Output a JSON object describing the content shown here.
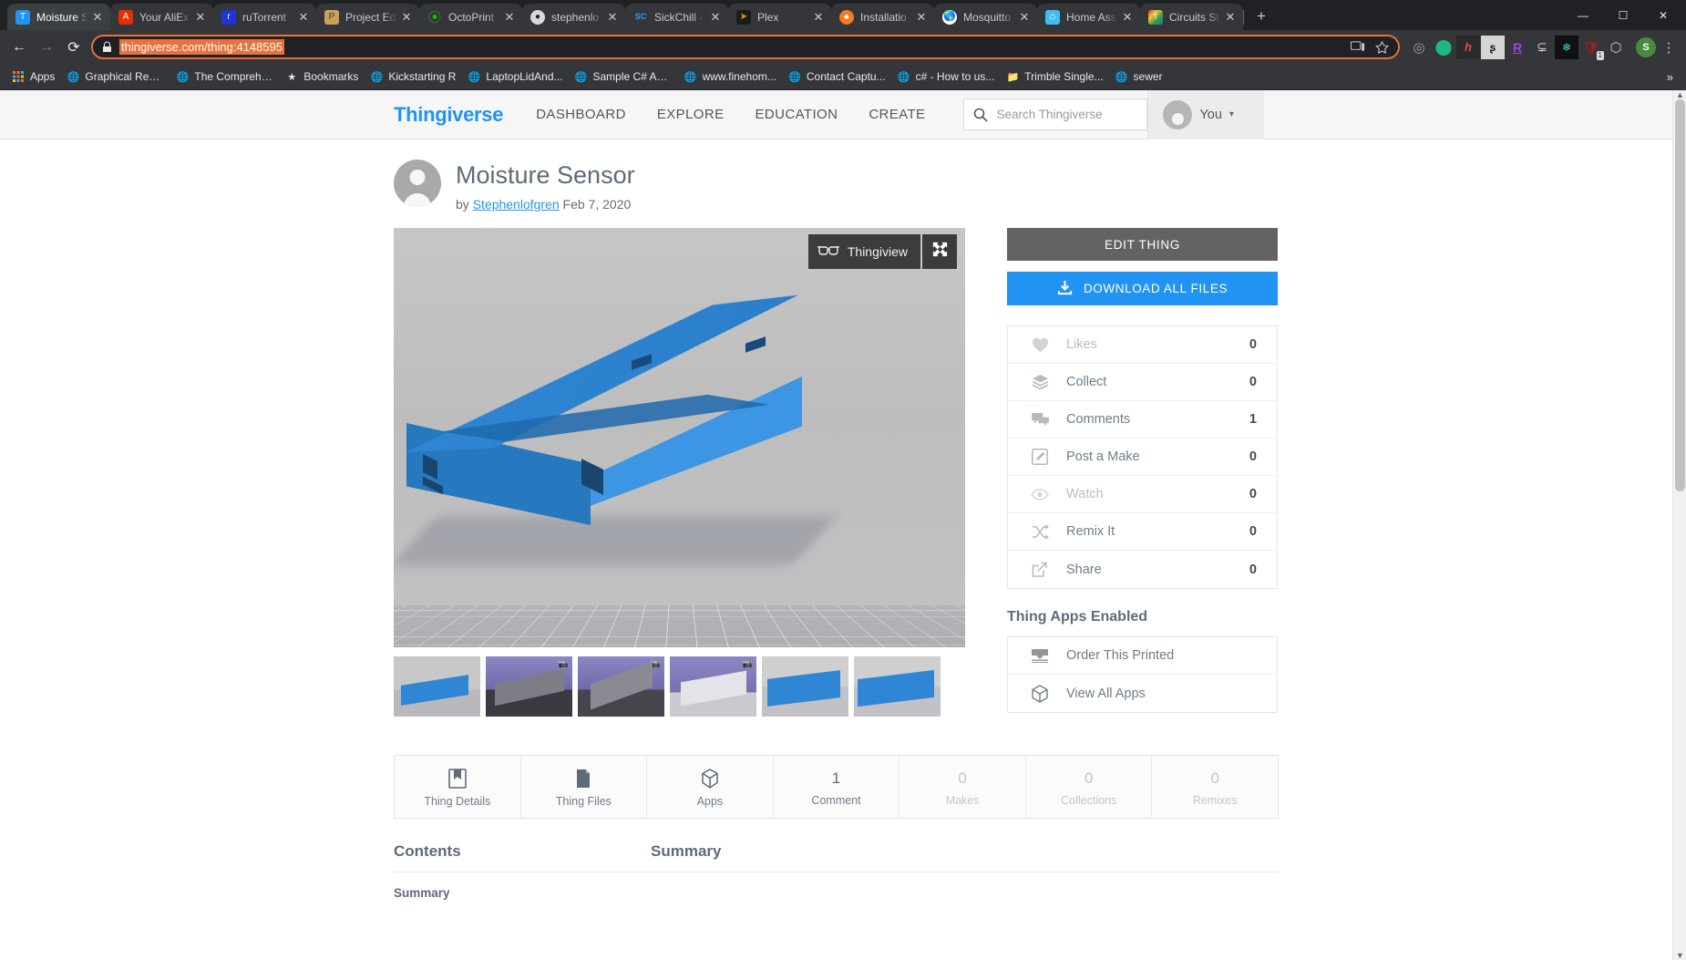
{
  "browser": {
    "tabs": [
      {
        "title": "Moisture S",
        "favicon": "thingiverse-icon",
        "active": true
      },
      {
        "title": "Your AliEx",
        "favicon": "aliexpress-icon",
        "active": false
      },
      {
        "title": "ruTorrent",
        "favicon": "rutorrent-icon",
        "active": false
      },
      {
        "title": "Project Ed",
        "favicon": "project-icon",
        "active": false
      },
      {
        "title": "OctoPrint",
        "favicon": "octoprint-icon",
        "active": false
      },
      {
        "title": "stephenlo",
        "favicon": "github-icon",
        "active": false
      },
      {
        "title": "SickChill -",
        "favicon": "sickchill-icon",
        "active": false
      },
      {
        "title": "Plex",
        "favicon": "plex-icon",
        "active": false
      },
      {
        "title": "Installatio",
        "favicon": "installation-icon",
        "active": false
      },
      {
        "title": "Mosquitto",
        "favicon": "mosquitto-icon",
        "active": false
      },
      {
        "title": "Home Ass",
        "favicon": "home-assistant-icon",
        "active": false
      },
      {
        "title": "Circuits St",
        "favicon": "tinkercad-icon",
        "active": false
      }
    ],
    "new_tab_label": "+",
    "window_controls": {
      "minimize": "—",
      "maximize": "☐",
      "close": "✕"
    },
    "close_label": "✕",
    "nav": {
      "back": "←",
      "forward": "→",
      "reload": "⟳"
    },
    "omnibox": {
      "url": "thingiverse.com/thing:4148595",
      "lock_icon": "lock-icon",
      "cast_icon": "cast-icon",
      "bookmark_icon": "star-icon"
    },
    "extensions": [
      {
        "name": "pocket-extension",
        "glyph": "◎",
        "color": "#9aa0a6",
        "badge": ""
      },
      {
        "name": "green-shield-extension",
        "glyph": "●",
        "color": "#1eb980",
        "badge": ""
      },
      {
        "name": "h-extension",
        "glyph": "h",
        "color": "#e04b4b",
        "badge": ""
      },
      {
        "name": "script-extension",
        "glyph": "ʃ",
        "color": "#ffffff",
        "badge": ""
      },
      {
        "name": "r-extension",
        "glyph": "R",
        "color": "#a63fd9",
        "badge": ""
      },
      {
        "name": "bracket-extension",
        "glyph": "⊃",
        "color": "#c8cacd",
        "badge": ""
      },
      {
        "name": "snowflake-extension",
        "glyph": "❅",
        "color": "#4ad3e0",
        "badge": ""
      },
      {
        "name": "ublock-extension",
        "glyph": "⛉",
        "color": "#ffffff",
        "badge": "1"
      },
      {
        "name": "ghostery-extension",
        "glyph": "⬡",
        "color": "#c8cacd",
        "badge": ""
      }
    ],
    "profile": {
      "name": "profile-avatar",
      "letter": "S",
      "color": "#4a8a3c"
    },
    "menu_label": "⋮",
    "bookmarks": [
      {
        "label": "Apps",
        "icon": "apps-grid-icon"
      },
      {
        "label": "Graphical Resi...",
        "icon": "globe-icon"
      },
      {
        "label": "The Comprehe...",
        "icon": "globe-icon"
      },
      {
        "label": "Bookmarks",
        "icon": "star-icon"
      },
      {
        "label": "Kickstarting R",
        "icon": "globe-icon"
      },
      {
        "label": "LaptopLidAnd...",
        "icon": "globe-icon"
      },
      {
        "label": "Sample C# API...",
        "icon": "globe-icon"
      },
      {
        "label": "www.finehom...",
        "icon": "globe-icon"
      },
      {
        "label": "Contact Captu...",
        "icon": "globe-icon"
      },
      {
        "label": "c# - How to us...",
        "icon": "globe-icon"
      },
      {
        "label": "Trimble Single...",
        "icon": "folder-icon"
      },
      {
        "label": "sewer",
        "icon": "globe-icon"
      }
    ],
    "bookmarks_overflow": "»"
  },
  "site": {
    "logo": "Thingiverse",
    "nav": [
      "DASHBOARD",
      "EXPLORE",
      "EDUCATION",
      "CREATE"
    ],
    "search_placeholder": "Search Thingiverse",
    "user_label": "You",
    "user_caret": "▾"
  },
  "thing": {
    "title": "Moisture Sensor",
    "by_label": "by",
    "author": "Stephenlofgren",
    "date": "Feb 7, 2020",
    "viewer": {
      "thingiview_label": "Thingiview",
      "thingiview_icon": "glasses-icon",
      "fullscreen_icon": "expand-icon"
    },
    "thumbnails": [
      {
        "name": "thumbnail-1"
      },
      {
        "name": "thumbnail-2"
      },
      {
        "name": "thumbnail-3"
      },
      {
        "name": "thumbnail-4"
      },
      {
        "name": "thumbnail-5"
      },
      {
        "name": "thumbnail-6"
      }
    ]
  },
  "sidebar": {
    "edit_thing": "EDIT THING",
    "download_all": "DOWNLOAD ALL FILES",
    "download_icon": "download-icon",
    "stats": [
      {
        "label": "Likes",
        "value": "0",
        "icon": "heart-icon",
        "muted": true
      },
      {
        "label": "Collect",
        "value": "0",
        "icon": "collect-icon",
        "muted": false
      },
      {
        "label": "Comments",
        "value": "1",
        "icon": "comment-icon",
        "muted": false
      },
      {
        "label": "Post a Make",
        "value": "0",
        "icon": "pencil-icon",
        "muted": false
      },
      {
        "label": "Watch",
        "value": "0",
        "icon": "eye-icon",
        "muted": true
      },
      {
        "label": "Remix It",
        "value": "0",
        "icon": "remix-icon",
        "muted": false
      },
      {
        "label": "Share",
        "value": "0",
        "icon": "share-icon",
        "muted": false
      }
    ],
    "apps_title": "Thing Apps Enabled",
    "apps": [
      {
        "label": "Order This Printed",
        "icon": "printer-icon"
      },
      {
        "label": "View All Apps",
        "icon": "cube-icon"
      }
    ]
  },
  "thing_tabs": [
    {
      "label": "Thing Details",
      "count": "",
      "icon": "book-icon",
      "dim": false
    },
    {
      "label": "Thing Files",
      "count": "",
      "icon": "files-icon",
      "dim": false
    },
    {
      "label": "Apps",
      "count": "",
      "icon": "cube-icon",
      "dim": false
    },
    {
      "label": "Comment",
      "count": "1",
      "icon": "",
      "dim": false
    },
    {
      "label": "Makes",
      "count": "0",
      "icon": "",
      "dim": true
    },
    {
      "label": "Collections",
      "count": "0",
      "icon": "",
      "dim": true
    },
    {
      "label": "Remixes",
      "count": "0",
      "icon": "",
      "dim": true
    }
  ],
  "sections": {
    "contents_heading": "Contents",
    "contents_sub": "Summary",
    "summary_heading": "Summary"
  }
}
